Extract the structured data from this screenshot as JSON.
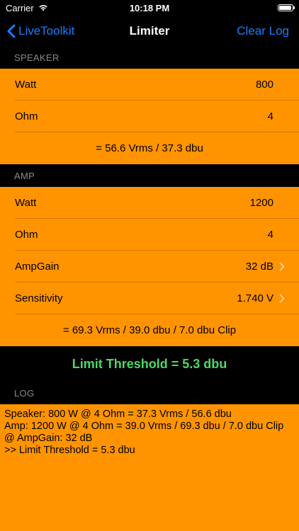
{
  "status_bar": {
    "carrier": "Carrier",
    "time": "10:18 PM",
    "battery_level": 0.95
  },
  "nav": {
    "back_label": "LiveToolkit",
    "title": "Limiter",
    "right_label": "Clear Log"
  },
  "speaker": {
    "header": "SPEAKER",
    "rows": [
      {
        "label": "Watt",
        "value": "800"
      },
      {
        "label": "Ohm",
        "value": "4"
      }
    ],
    "summary": "= 56.6 Vrms / 37.3 dbu"
  },
  "amp": {
    "header": "AMP",
    "rows": [
      {
        "label": "Watt",
        "value": "1200"
      },
      {
        "label": "Ohm",
        "value": "4"
      },
      {
        "label": "AmpGain",
        "value": "32 dB"
      },
      {
        "label": "Sensitivity",
        "value": "1.740 V"
      }
    ],
    "summary": "= 69.3 Vrms / 39.0 dbu / 7.0 dbu Clip"
  },
  "threshold": "Limit Threshold = 5.3 dbu",
  "log": {
    "header": "LOG",
    "lines": [
      "Speaker: 800 W @ 4 Ohm = 37.3 Vrms / 56.6 dbu",
      "Amp: 1200 W @ 4 Ohm = 39.0 Vrms / 69.3 dbu / 7.0 dbu Clip",
      "@ AmpGain: 32 dB",
      ">> Limit Threshold = 5.3 dbu"
    ]
  },
  "colors": {
    "accent_blue": "#1a7dff",
    "orange": "#ff9400",
    "threshold_green": "#4cd964"
  }
}
